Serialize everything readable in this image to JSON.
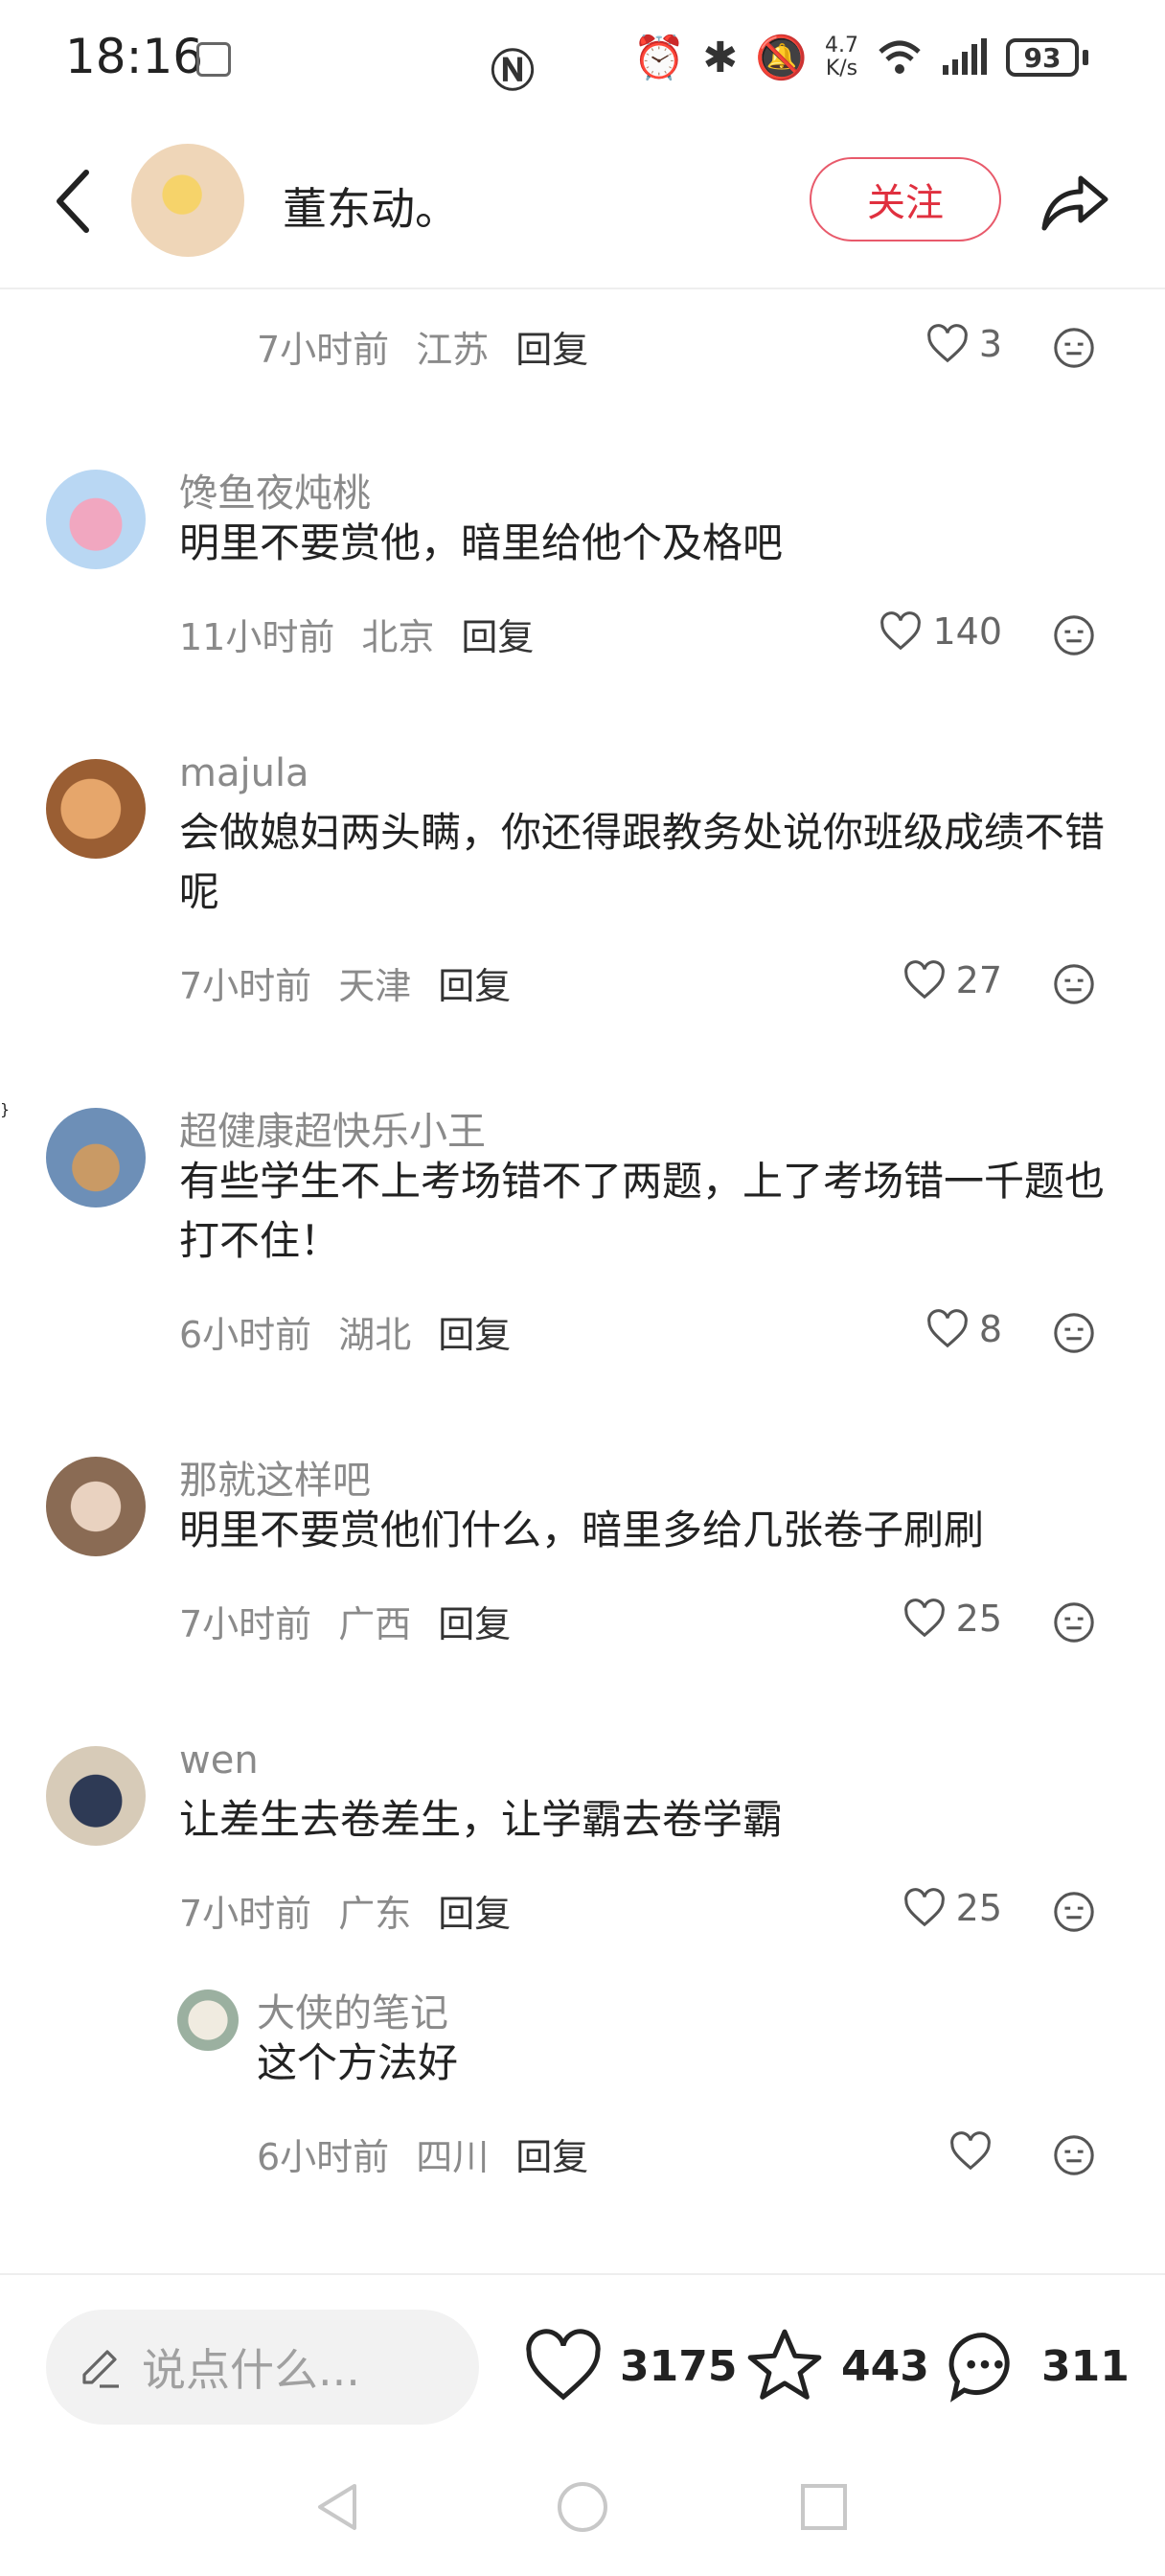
{
  "status_bar": {
    "time": "18:16",
    "net_speed_value": "4.7",
    "net_speed_unit": "K/s",
    "battery": "93",
    "icons": [
      "gallery-icon",
      "nfc-icon",
      "alarm-icon",
      "bluetooth-icon",
      "mute-icon",
      "wifi-icon",
      "signal-icon",
      "battery-icon"
    ]
  },
  "header": {
    "author_name": "董东动。",
    "follow_label": "关注"
  },
  "comments": [
    {
      "meta": {
        "time": "7小时前",
        "location": "江苏",
        "reply": "回复",
        "likes": "3"
      }
    },
    {
      "name": "馋鱼夜炖桃",
      "text": "明里不要赏他，暗里给他个及格吧",
      "meta": {
        "time": "11小时前",
        "location": "北京",
        "reply": "回复",
        "likes": "140"
      }
    },
    {
      "name": "majula",
      "text": "会做媳妇两头瞒，你还得跟教务处说你班级成绩不错呢",
      "meta": {
        "time": "7小时前",
        "location": "天津",
        "reply": "回复",
        "likes": "27"
      }
    },
    {
      "name": "超健康超快乐小王",
      "text": "有些学生不上考场错不了两题，上了考场错一千题也打不住！",
      "meta": {
        "time": "6小时前",
        "location": "湖北",
        "reply": "回复",
        "likes": "8"
      }
    },
    {
      "name": "那就这样吧",
      "text": "明里不要赏他们什么，暗里多给几张卷子刷刷",
      "meta": {
        "time": "7小时前",
        "location": "广西",
        "reply": "回复",
        "likes": "25"
      }
    },
    {
      "name": "wen",
      "text": "让差生去卷差生，让学霸去卷学霸",
      "meta": {
        "time": "7小时前",
        "location": "广东",
        "reply": "回复",
        "likes": "25"
      }
    },
    {
      "name": "大侠的笔记",
      "text": "这个方法好",
      "meta": {
        "time": "6小时前",
        "location": "四川",
        "reply": "回复",
        "likes": ""
      }
    }
  ],
  "bottom_bar": {
    "input_placeholder": "说点什么...",
    "likes": "3175",
    "favorites": "443",
    "comments": "311"
  },
  "colors": {
    "accent": "#e0303f",
    "text": "#222222",
    "muted": "#8a8a8a"
  }
}
